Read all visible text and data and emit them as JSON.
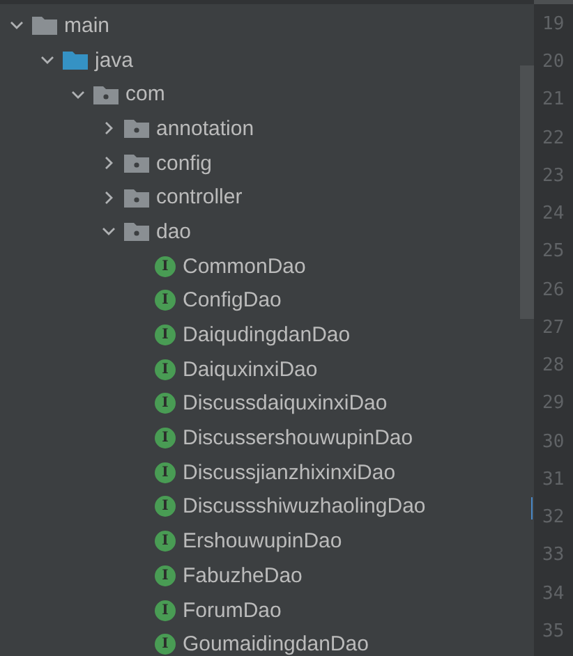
{
  "tree": [
    {
      "label": "main",
      "kind": "folder",
      "expanded": true,
      "children": [
        {
          "label": "java",
          "kind": "source-folder",
          "expanded": true,
          "children": [
            {
              "label": "com",
              "kind": "package",
              "expanded": true,
              "children": [
                {
                  "label": "annotation",
                  "kind": "package",
                  "expanded": false
                },
                {
                  "label": "config",
                  "kind": "package",
                  "expanded": false
                },
                {
                  "label": "controller",
                  "kind": "package",
                  "expanded": false
                },
                {
                  "label": "dao",
                  "kind": "package",
                  "expanded": true,
                  "children": [
                    {
                      "label": "CommonDao",
                      "kind": "interface",
                      "badge": "I"
                    },
                    {
                      "label": "ConfigDao",
                      "kind": "interface",
                      "badge": "I"
                    },
                    {
                      "label": "DaiqudingdanDao",
                      "kind": "interface",
                      "badge": "I"
                    },
                    {
                      "label": "DaiquxinxiDao",
                      "kind": "interface",
                      "badge": "I"
                    },
                    {
                      "label": "DiscussdaiquxinxiDao",
                      "kind": "interface",
                      "badge": "I"
                    },
                    {
                      "label": "DiscussershouwupinDao",
                      "kind": "interface",
                      "badge": "I"
                    },
                    {
                      "label": "DiscussjianzhixinxiDao",
                      "kind": "interface",
                      "badge": "I"
                    },
                    {
                      "label": "DiscussshiwuzhaolingDao",
                      "kind": "interface",
                      "badge": "I"
                    },
                    {
                      "label": "ErshouwupinDao",
                      "kind": "interface",
                      "badge": "I"
                    },
                    {
                      "label": "FabuzheDao",
                      "kind": "interface",
                      "badge": "I"
                    },
                    {
                      "label": "ForumDao",
                      "kind": "interface",
                      "badge": "I"
                    },
                    {
                      "label": "GoumaidingdanDao",
                      "kind": "interface",
                      "badge": "I"
                    }
                  ]
                }
              ]
            }
          ]
        }
      ]
    }
  ],
  "editor": {
    "line_numbers": [
      "19",
      "20",
      "21",
      "22",
      "23",
      "24",
      "25",
      "26",
      "27",
      "28",
      "29",
      "30",
      "31",
      "32",
      "33",
      "34",
      "35"
    ]
  }
}
